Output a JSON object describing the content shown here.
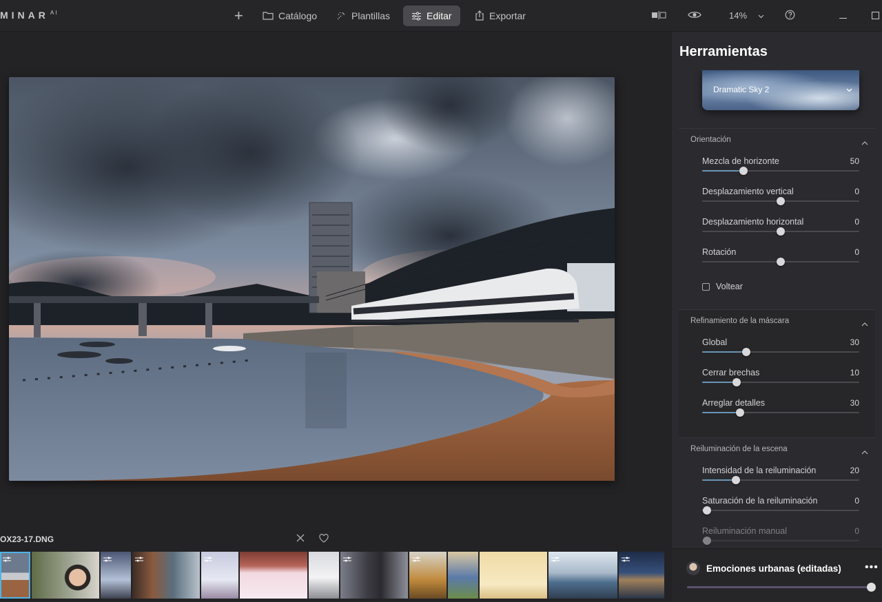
{
  "app": {
    "logo": "MINAR",
    "logo_sup": "AI"
  },
  "toolbar": {
    "add": "+",
    "catalog": "Catálogo",
    "templates": "Plantillas",
    "edit": "Editar",
    "export": "Exportar",
    "zoom": "14%",
    "icons": [
      "plus-icon",
      "folder-icon",
      "sparkle-icon",
      "sliders-icon",
      "share-icon",
      "compare-icon",
      "eye-icon",
      "chevron-down-icon",
      "help-icon",
      "minimize-icon",
      "maximize-icon"
    ]
  },
  "filmstrip": {
    "filename": "OX23-17.DNG",
    "selected_index": 0,
    "thumb_count": 15
  },
  "panel": {
    "title": "Herramientas",
    "sky": {
      "selected": "Dramatic Sky 2"
    },
    "orientation": {
      "title": "Orientación",
      "sliders": [
        {
          "label": "Mezcla de horizonte",
          "value": "50",
          "pos": 0.265,
          "centered": false
        },
        {
          "label": "Desplazamiento vertical",
          "value": "0",
          "pos": 0.5,
          "centered": true
        },
        {
          "label": "Desplazamiento horizontal",
          "value": "0",
          "pos": 0.5,
          "centered": true
        },
        {
          "label": "Rotación",
          "value": "0",
          "pos": 0.5,
          "centered": true
        }
      ],
      "flip_label": "Voltear",
      "flip_checked": false
    },
    "mask": {
      "title": "Refinamiento de la máscara",
      "sliders": [
        {
          "label": "Global",
          "value": "30",
          "pos": 0.28
        },
        {
          "label": "Cerrar brechas",
          "value": "10",
          "pos": 0.22
        },
        {
          "label": "Arreglar detalles",
          "value": "30",
          "pos": 0.24
        }
      ]
    },
    "relight": {
      "title": "Reiluminación de la escena",
      "sliders": [
        {
          "label": "Intensidad de la reiluminación",
          "value": "20",
          "pos": 0.215
        },
        {
          "label": "Saturación de la reiluminación",
          "value": "0",
          "pos": 0.03
        },
        {
          "label": "Reiluminación manual",
          "value": "0",
          "pos": 0.03
        }
      ]
    }
  },
  "preset": {
    "name": "Emociones urbanas (editadas)",
    "more": "•••",
    "amount": 1.0
  }
}
